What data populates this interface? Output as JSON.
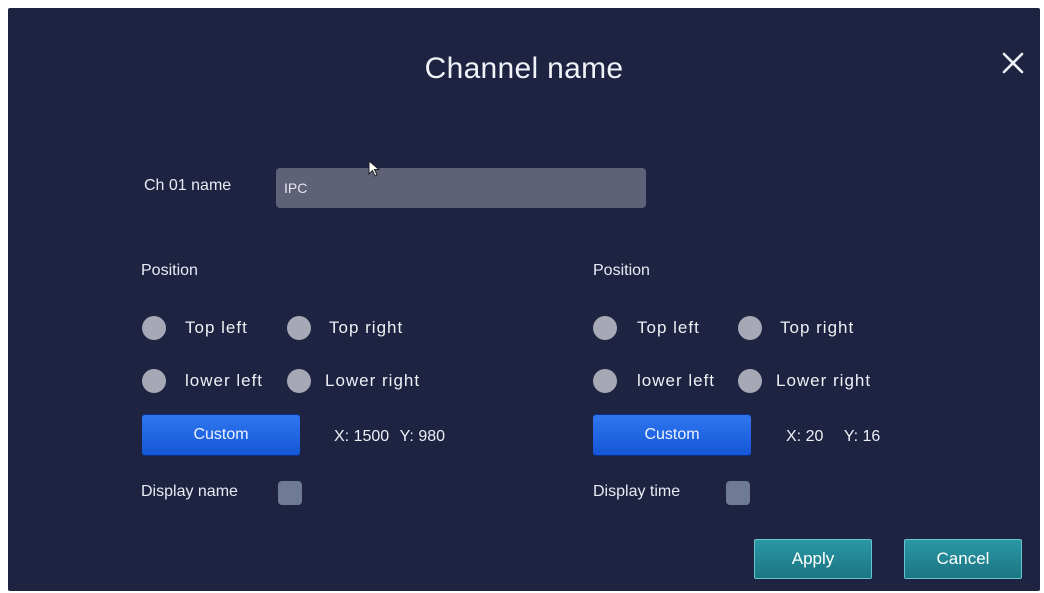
{
  "dialog": {
    "title": "Channel name",
    "close_icon": "close-icon"
  },
  "channel": {
    "label": "Ch 01 name",
    "value": "IPC"
  },
  "left_panel": {
    "position_label": "Position",
    "options": [
      "Top left",
      "Top right",
      "lower left",
      "Lower right"
    ],
    "custom_label": "Custom",
    "x_label": "X:",
    "x_value": "1500",
    "y_label": "Y:",
    "y_value": "980",
    "toggle_label": "Display name"
  },
  "right_panel": {
    "position_label": "Position",
    "options": [
      "Top left",
      "Top right",
      "lower left",
      "Lower right"
    ],
    "custom_label": "Custom",
    "x_label": "X:",
    "x_value": "20",
    "y_label": "Y:",
    "y_value": "16",
    "toggle_label": "Display time"
  },
  "actions": {
    "apply": "Apply",
    "cancel": "Cancel"
  },
  "colors": {
    "background": "#1d2340",
    "input": "#5e6177",
    "radio": "#a6a9b5",
    "custom_button": "#1f63e0",
    "action_button": "#2288a0"
  }
}
